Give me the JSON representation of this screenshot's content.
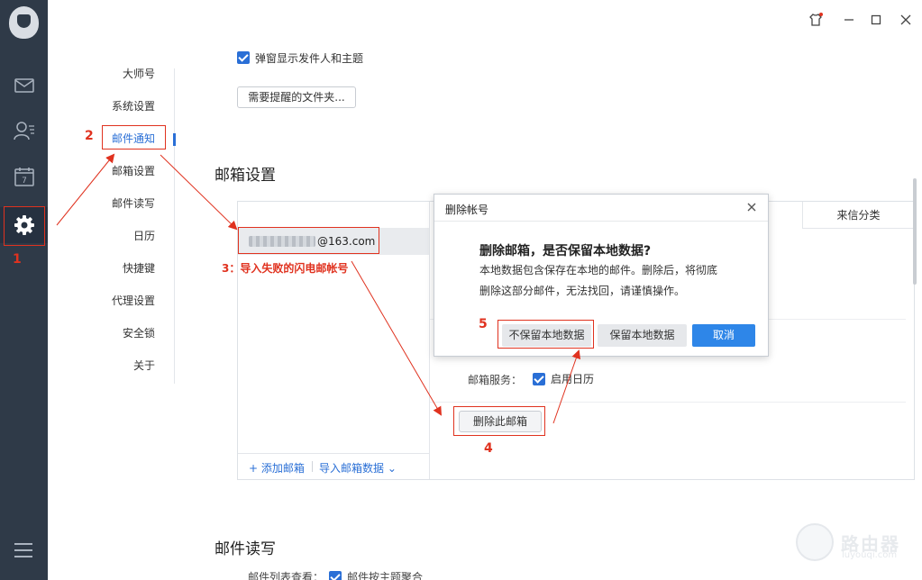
{
  "window": {
    "skin_label": "",
    "min_label": "–",
    "max_label": "☐",
    "close_label": "✕"
  },
  "rail": {
    "items": [
      {
        "icon": "mail-icon"
      },
      {
        "icon": "contacts-icon"
      },
      {
        "icon": "calendar-icon",
        "day": "7"
      },
      {
        "icon": "settings-icon"
      },
      {
        "icon": "menu-icon"
      }
    ]
  },
  "settings_nav": {
    "items": [
      "大师号",
      "系统设置",
      "邮件通知",
      "邮箱设置",
      "邮件读写",
      "日历",
      "快捷键",
      "代理设置",
      "安全锁",
      "关于"
    ],
    "active_index": 2
  },
  "notify": {
    "popup_checkbox_label": "弹窗显示发件人和主题",
    "folders_button": "需要提醒的文件夹..."
  },
  "mailbox": {
    "section_title": "邮箱设置",
    "account_email": "@163.com",
    "add_label": "+ 添加邮箱",
    "import_label": "导入邮箱数据 ⌄",
    "column_header": "来信分类",
    "service_label": "邮箱服务：",
    "calendar_checkbox": "启用日历",
    "delete_mailbox_button": "删除此邮箱"
  },
  "mail_rw": {
    "section_title": "邮件读写",
    "list_view_label": "邮件列表查看：",
    "thread_checkbox": "邮件按主题聚合"
  },
  "dialog": {
    "title": "删除帐号",
    "question": "删除邮箱，是否保留本地数据?",
    "message_line1": "本地数据包含保存在本地的邮件。删除后，将彻底",
    "message_line2": "删除这部分邮件，无法找回，请谨慎操作。",
    "btn_no_keep": "不保留本地数据",
    "btn_keep": "保留本地数据",
    "btn_cancel": "取消"
  },
  "annotations": {
    "n1": "1",
    "n2": "2",
    "n3": "3：导入失败的闪电邮帐号",
    "n4": "4",
    "n5": "5",
    "color": "#e0321f"
  },
  "watermark": {
    "text": "路由器",
    "sub": "luyouqi.com"
  },
  "colors": {
    "accent": "#2a6fd6",
    "rail": "#2f3a48",
    "primary_button": "#2e86e8"
  }
}
